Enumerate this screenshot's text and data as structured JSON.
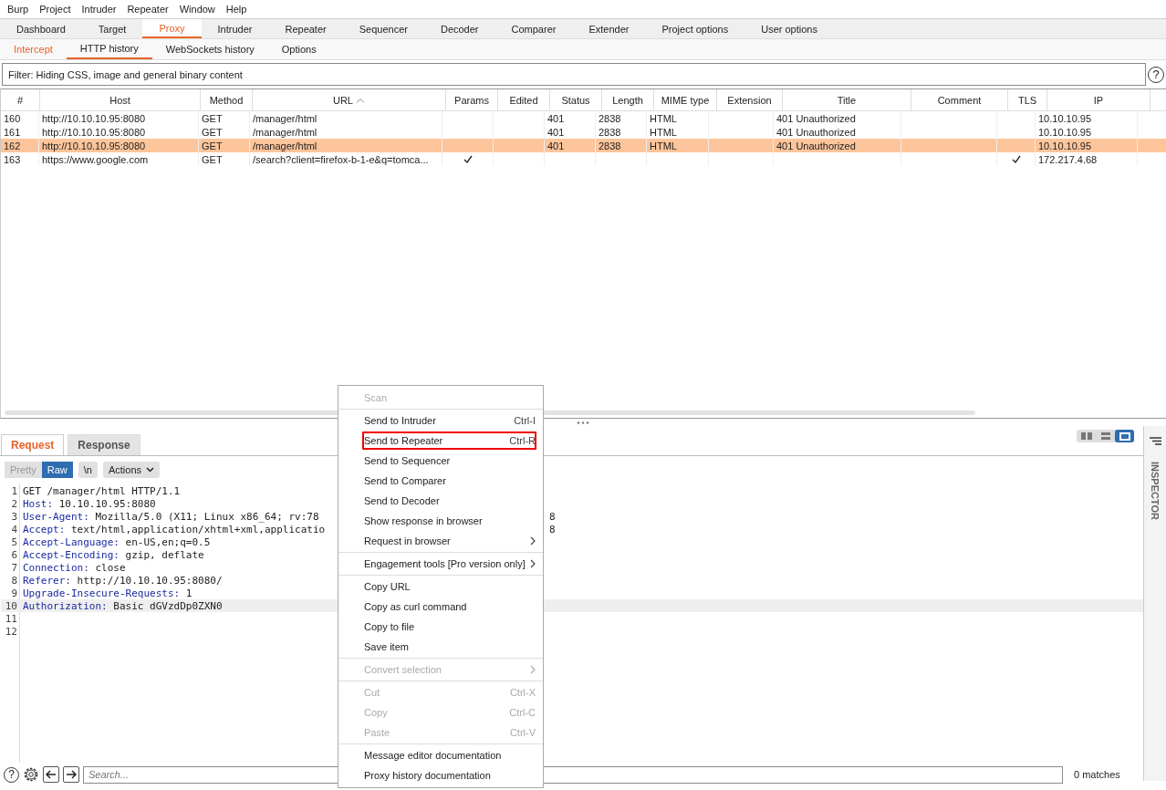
{
  "menu_bar": [
    "Burp",
    "Project",
    "Intruder",
    "Repeater",
    "Window",
    "Help"
  ],
  "main_tabs": [
    {
      "label": "Dashboard",
      "selected": false
    },
    {
      "label": "Target",
      "selected": false
    },
    {
      "label": "Proxy",
      "selected": true
    },
    {
      "label": "Intruder",
      "selected": false
    },
    {
      "label": "Repeater",
      "selected": false
    },
    {
      "label": "Sequencer",
      "selected": false
    },
    {
      "label": "Decoder",
      "selected": false
    },
    {
      "label": "Comparer",
      "selected": false
    },
    {
      "label": "Extender",
      "selected": false
    },
    {
      "label": "Project options",
      "selected": false
    },
    {
      "label": "User options",
      "selected": false
    }
  ],
  "sub_tabs": [
    {
      "label": "Intercept",
      "selected": false,
      "highlighted": true
    },
    {
      "label": "HTTP history",
      "selected": true,
      "highlighted": false
    },
    {
      "label": "WebSockets history",
      "selected": false,
      "highlighted": false
    },
    {
      "label": "Options",
      "selected": false,
      "highlighted": false
    }
  ],
  "filter": "Filter: Hiding CSS, image and general binary content",
  "filter_help": "?",
  "table": {
    "columns": [
      {
        "label": "#",
        "sorted": false
      },
      {
        "label": "Host",
        "sorted": false
      },
      {
        "label": "Method",
        "sorted": false
      },
      {
        "label": "URL",
        "sorted": true
      },
      {
        "label": "Params",
        "sorted": false
      },
      {
        "label": "Edited",
        "sorted": false
      },
      {
        "label": "Status",
        "sorted": false
      },
      {
        "label": "Length",
        "sorted": false
      },
      {
        "label": "MIME type",
        "sorted": false
      },
      {
        "label": "Extension",
        "sorted": false
      },
      {
        "label": "Title",
        "sorted": false
      },
      {
        "label": "Comment",
        "sorted": false
      },
      {
        "label": "TLS",
        "sorted": false
      },
      {
        "label": "IP",
        "sorted": false
      }
    ],
    "rows": [
      {
        "num": "160",
        "host": "http://10.10.10.95:8080",
        "method": "GET",
        "url": "/manager/html",
        "params": false,
        "status": "401",
        "length": "2838",
        "mime": "HTML",
        "title": "401 Unauthorized",
        "tls": false,
        "ip": "10.10.10.95",
        "selected": false
      },
      {
        "num": "161",
        "host": "http://10.10.10.95:8080",
        "method": "GET",
        "url": "/manager/html",
        "params": false,
        "status": "401",
        "length": "2838",
        "mime": "HTML",
        "title": "401 Unauthorized",
        "tls": false,
        "ip": "10.10.10.95",
        "selected": false
      },
      {
        "num": "162",
        "host": "http://10.10.10.95:8080",
        "method": "GET",
        "url": "/manager/html",
        "params": false,
        "status": "401",
        "length": "2838",
        "mime": "HTML",
        "title": "401 Unauthorized",
        "tls": false,
        "ip": "10.10.10.95",
        "selected": true
      },
      {
        "num": "163",
        "host": "https://www.google.com",
        "method": "GET",
        "url": "/search?client=firefox-b-1-e&q=tomca...",
        "params": true,
        "tls": true,
        "ip": "172.217.4.68",
        "selected": false
      }
    ]
  },
  "editor": {
    "tabs": [
      {
        "label": "Request",
        "selected": true
      },
      {
        "label": "Response",
        "selected": false
      }
    ],
    "view_buttons": [
      {
        "label": "Pretty",
        "selected": false
      },
      {
        "label": "Raw",
        "selected": true
      },
      {
        "label": "\\n",
        "selected": false
      }
    ],
    "actions": "Actions",
    "layout_modes": [
      {
        "selected": false
      },
      {
        "selected": false
      },
      {
        "selected": true
      }
    ],
    "lines": [
      {
        "num": "1",
        "value": "GET /manager/html HTTP/1.1",
        "current": false
      },
      {
        "num": "2",
        "key": "Host:",
        "value": " 10.10.10.95:8080",
        "current": false
      },
      {
        "num": "3",
        "key": "User-Agent:",
        "value": " Mozilla/5.0 (X11; Linux x86_64; rv:78",
        "tail": "8",
        "current": false
      },
      {
        "num": "4",
        "key": "Accept:",
        "value": " text/html,application/xhtml+xml,applicatio",
        "tail": "8",
        "current": false
      },
      {
        "num": "5",
        "key": "Accept-Language:",
        "value": " en-US,en;q=0.5",
        "current": false
      },
      {
        "num": "6",
        "key": "Accept-Encoding:",
        "value": " gzip, deflate",
        "current": false
      },
      {
        "num": "7",
        "key": "Connection:",
        "value": " close",
        "current": false
      },
      {
        "num": "8",
        "key": "Referer:",
        "value": " http://10.10.10.95:8080/",
        "current": false
      },
      {
        "num": "9",
        "key": "Upgrade-Insecure-Requests:",
        "value": " 1",
        "current": false
      },
      {
        "num": "10",
        "key": "Authorization:",
        "value": " Basic dGVzdDp0ZXN0",
        "current": true
      },
      {
        "num": "11",
        "current": false
      },
      {
        "num": "12",
        "current": false
      }
    ],
    "help": "?",
    "search": {
      "placeholder": "Search..."
    },
    "matches": "0 matches"
  },
  "inspector": "INSPECTOR",
  "context_menu": [
    [
      {
        "label": "Scan",
        "disabled": true,
        "outlined": false,
        "submenu": false
      }
    ],
    [
      {
        "label": "Send to Intruder",
        "shortcut": "Ctrl-I",
        "disabled": false,
        "outlined": false,
        "submenu": false
      },
      {
        "label": "Send to Repeater",
        "shortcut": "Ctrl-R",
        "disabled": false,
        "outlined": true,
        "submenu": false
      },
      {
        "label": "Send to Sequencer",
        "disabled": false,
        "outlined": false,
        "submenu": false
      },
      {
        "label": "Send to Comparer",
        "disabled": false,
        "outlined": false,
        "submenu": false
      },
      {
        "label": "Send to Decoder",
        "disabled": false,
        "outlined": false,
        "submenu": false
      },
      {
        "label": "Show response in browser",
        "disabled": false,
        "outlined": false,
        "submenu": false
      },
      {
        "label": "Request in browser",
        "disabled": false,
        "outlined": false,
        "submenu": true
      }
    ],
    [
      {
        "label": "Engagement tools [Pro version only]",
        "disabled": false,
        "outlined": false,
        "submenu": true
      }
    ],
    [
      {
        "label": "Copy URL",
        "disabled": false,
        "outlined": false,
        "submenu": false
      },
      {
        "label": "Copy as curl command",
        "disabled": false,
        "outlined": false,
        "submenu": false
      },
      {
        "label": "Copy to file",
        "disabled": false,
        "outlined": false,
        "submenu": false
      },
      {
        "label": "Save item",
        "disabled": false,
        "outlined": false,
        "submenu": false
      }
    ],
    [
      {
        "label": "Convert selection",
        "disabled": true,
        "outlined": false,
        "submenu": true
      }
    ],
    [
      {
        "label": "Cut",
        "shortcut": "Ctrl-X",
        "disabled": true,
        "outlined": false,
        "submenu": false
      },
      {
        "label": "Copy",
        "shortcut": "Ctrl-C",
        "disabled": true,
        "outlined": false,
        "submenu": false
      },
      {
        "label": "Paste",
        "shortcut": "Ctrl-V",
        "disabled": true,
        "outlined": false,
        "submenu": false
      }
    ],
    [
      {
        "label": "Message editor documentation",
        "disabled": false,
        "outlined": false,
        "submenu": false
      },
      {
        "label": "Proxy history documentation",
        "disabled": false,
        "outlined": false,
        "submenu": false
      }
    ]
  ]
}
